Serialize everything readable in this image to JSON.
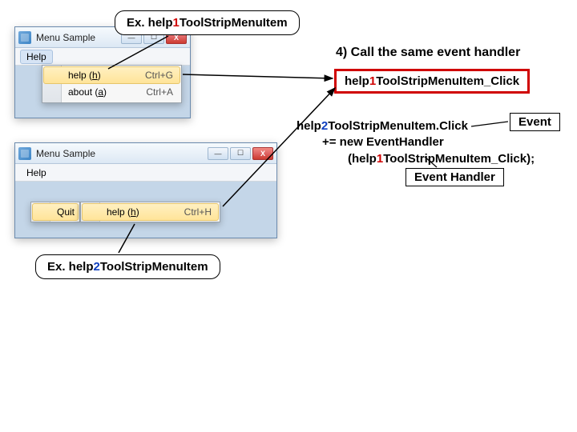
{
  "callout_top": {
    "prefix": "Ex. help",
    "num": "1",
    "suffix": "ToolStripMenuItem"
  },
  "callout_bottom": {
    "prefix": "Ex. help",
    "num": "2",
    "suffix": "ToolStripMenuItem"
  },
  "window_title": "Menu Sample",
  "menu_help": "Help",
  "menu1": {
    "items": [
      {
        "before": "help (",
        "mn": "h",
        "after": ")",
        "accel": "Ctrl+G",
        "hi": true
      },
      {
        "before": "about (",
        "mn": "a",
        "after": ")",
        "accel": "Ctrl+A",
        "hi": false
      }
    ]
  },
  "menu2": {
    "quit": "Quit",
    "sub": {
      "before": "help (",
      "mn": "h",
      "after": ")",
      "accel": "Ctrl+H"
    }
  },
  "step": "4) Call the same event handler",
  "handler": {
    "prefix": "help",
    "num": "1",
    "suffix": "ToolStripMenuItem_Click"
  },
  "code": {
    "line1a": "help",
    "line1num": "2",
    "line1b": "ToolStripMenuItem.Click",
    "line2": "+= new EventHandler",
    "line3a": "(help",
    "line3num": "1",
    "line3b": "ToolStripMenuItem_Click);"
  },
  "tag_event": "Event",
  "tag_handler": "Event Handler",
  "sysbtn": {
    "min": "—",
    "max": "☐",
    "close": "X"
  }
}
